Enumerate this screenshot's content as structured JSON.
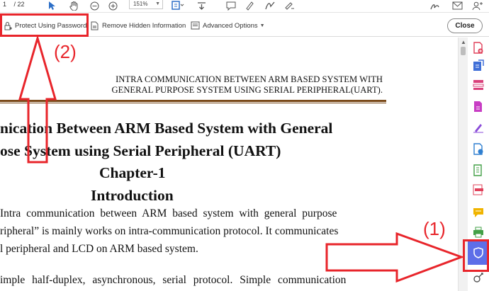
{
  "toolbar": {
    "page_current": "1",
    "page_total": "/ 22",
    "zoom": "151%"
  },
  "protect_bar": {
    "protect_label": "Protect Using Password",
    "remove_label": "Remove Hidden Information",
    "advanced_label": "Advanced Options",
    "close_label": "Close"
  },
  "document": {
    "running_head_line1": "INTRA COMMUNICATION BETWEEN ARM BASED SYSTEM WITH",
    "running_head_line2": "GENERAL PURPOSE SYSTEM USING SERIAL PERIPHERAL(UART).",
    "title_line1": "nication Between ARM Based System with General",
    "title_line2": "ose System using Serial Peripheral (UART)",
    "chapter": "Chapter-1",
    "section": "Introduction",
    "para_line1": "Intra communication between ARM based system with general purpose",
    "para_line2": "ripheral” is mainly works on intra-communication protocol. It communicates",
    "para_line3": "l peripheral and LCD on ARM based system.",
    "para_line4": "imple half-duplex, asynchronous, serial protocol. Simple communication"
  },
  "annotations": {
    "step1": "(1)",
    "step2": "(2)"
  },
  "colors": {
    "annotation_red": "#e8252b",
    "active_tool_blue": "#5d6ee8",
    "rule_brown": "#7a4a1a"
  }
}
